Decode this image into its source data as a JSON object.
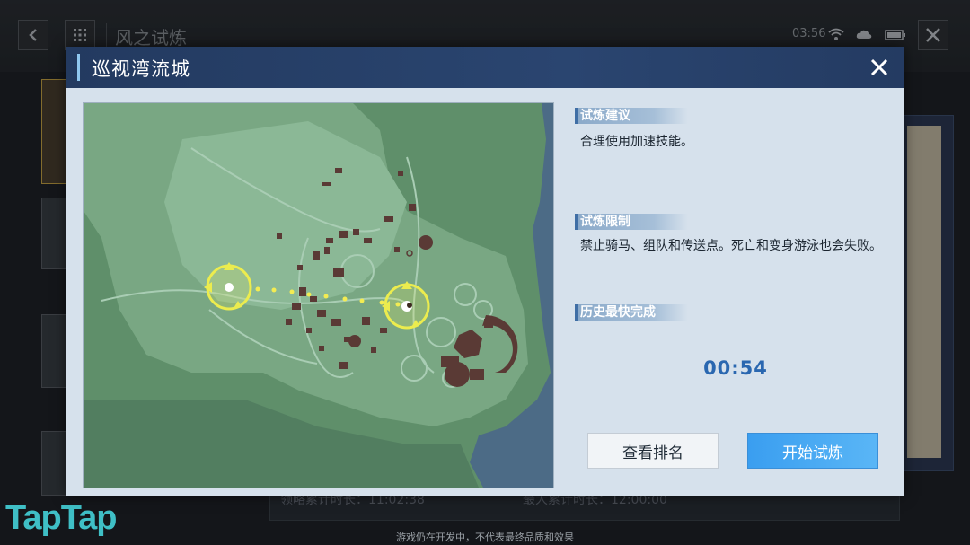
{
  "background": {
    "title": "风之试炼",
    "time": "03:56",
    "bottom_left_label": "领略累计时长：",
    "bottom_left_value": "11:02:38",
    "bottom_right_label": "最大累计时长：",
    "bottom_right_value": "12:00:00",
    "footer_note": "游戏仍在开发中，不代表最终品质和效果",
    "watermark": "TapTap",
    "icons": {
      "back": "back-arrow-icon",
      "grid": "grid-menu-icon",
      "wifi": "wifi-icon",
      "cloud": "cloud-icon",
      "battery": "battery-icon",
      "close": "close-icon"
    }
  },
  "modal": {
    "title": "巡视湾流城",
    "close_icon": "close-icon",
    "sections": [
      {
        "tag": "试炼建议",
        "text": "合理使用加速技能。"
      },
      {
        "tag": "试炼限制",
        "text": "禁止骑马、组队和传送点。死亡和变身游泳也会失败。"
      },
      {
        "tag": "历史最快完成",
        "text": ""
      }
    ],
    "best_time": "00:54",
    "buttons": {
      "rank": "查看排名",
      "start": "开始试炼"
    }
  },
  "colors": {
    "header": "#233a60",
    "panel": "#d6e1ec",
    "accent_blue": "#3a9ef0",
    "time_blue": "#2a67b0",
    "map_marker": "#e8e84a"
  }
}
